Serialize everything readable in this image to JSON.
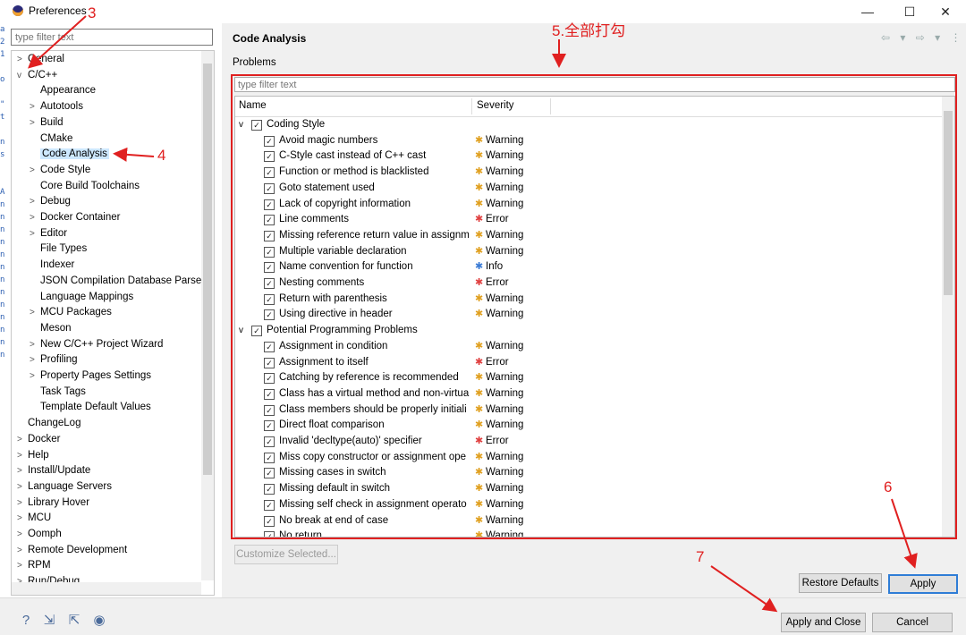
{
  "window": {
    "title": "Preferences",
    "minimize": "—",
    "maximize": "☐",
    "close": "✕"
  },
  "left_strip": [
    "a",
    "2",
    "1",
    "",
    "o",
    "",
    "\"",
    "t",
    "",
    "n",
    "s",
    "",
    "",
    "A",
    "n",
    "n",
    "n",
    "n",
    "n",
    "n",
    "n",
    "n",
    "n",
    "n",
    "n",
    "n",
    "n"
  ],
  "filter": {
    "placeholder": "type filter text"
  },
  "tree": [
    {
      "label": "General",
      "arrow": ">",
      "level": 0
    },
    {
      "label": "C/C++",
      "arrow": "v",
      "level": 0
    },
    {
      "label": "Appearance",
      "arrow": "",
      "level": 1
    },
    {
      "label": "Autotools",
      "arrow": ">",
      "level": 1
    },
    {
      "label": "Build",
      "arrow": ">",
      "level": 1
    },
    {
      "label": "CMake",
      "arrow": "",
      "level": 1
    },
    {
      "label": "Code Analysis",
      "arrow": "",
      "level": 1,
      "selected": true
    },
    {
      "label": "Code Style",
      "arrow": ">",
      "level": 1
    },
    {
      "label": "Core Build Toolchains",
      "arrow": "",
      "level": 1
    },
    {
      "label": "Debug",
      "arrow": ">",
      "level": 1
    },
    {
      "label": "Docker Container",
      "arrow": ">",
      "level": 1
    },
    {
      "label": "Editor",
      "arrow": ">",
      "level": 1
    },
    {
      "label": "File Types",
      "arrow": "",
      "level": 1
    },
    {
      "label": "Indexer",
      "arrow": "",
      "level": 1
    },
    {
      "label": "JSON Compilation Database Parse",
      "arrow": "",
      "level": 1
    },
    {
      "label": "Language Mappings",
      "arrow": "",
      "level": 1
    },
    {
      "label": "MCU Packages",
      "arrow": ">",
      "level": 1
    },
    {
      "label": "Meson",
      "arrow": "",
      "level": 1
    },
    {
      "label": "New C/C++ Project Wizard",
      "arrow": ">",
      "level": 1
    },
    {
      "label": "Profiling",
      "arrow": ">",
      "level": 1
    },
    {
      "label": "Property Pages Settings",
      "arrow": ">",
      "level": 1
    },
    {
      "label": "Task Tags",
      "arrow": "",
      "level": 1
    },
    {
      "label": "Template Default Values",
      "arrow": "",
      "level": 1
    },
    {
      "label": "ChangeLog",
      "arrow": "",
      "level": 0
    },
    {
      "label": "Docker",
      "arrow": ">",
      "level": 0
    },
    {
      "label": "Help",
      "arrow": ">",
      "level": 0
    },
    {
      "label": "Install/Update",
      "arrow": ">",
      "level": 0
    },
    {
      "label": "Language Servers",
      "arrow": ">",
      "level": 0
    },
    {
      "label": "Library Hover",
      "arrow": ">",
      "level": 0
    },
    {
      "label": "MCU",
      "arrow": ">",
      "level": 0
    },
    {
      "label": "Oomph",
      "arrow": ">",
      "level": 0
    },
    {
      "label": "Remote Development",
      "arrow": ">",
      "level": 0
    },
    {
      "label": "RPM",
      "arrow": ">",
      "level": 0
    },
    {
      "label": "Run/Debug",
      "arrow": ">",
      "level": 0
    }
  ],
  "main": {
    "title": "Code Analysis",
    "section_label": "Problems",
    "filter_placeholder": "type filter text",
    "columns": {
      "name": "Name",
      "severity": "Severity"
    },
    "rows": [
      {
        "type": "group",
        "name": "Coding Style"
      },
      {
        "type": "item",
        "name": "Avoid magic numbers",
        "severity": "Warning"
      },
      {
        "type": "item",
        "name": "C-Style cast instead of C++ cast",
        "severity": "Warning"
      },
      {
        "type": "item",
        "name": "Function or method is blacklisted",
        "severity": "Warning"
      },
      {
        "type": "item",
        "name": "Goto statement used",
        "severity": "Warning"
      },
      {
        "type": "item",
        "name": "Lack of copyright information",
        "severity": "Warning"
      },
      {
        "type": "item",
        "name": "Line comments",
        "severity": "Error"
      },
      {
        "type": "item",
        "name": "Missing reference return value in assignm",
        "severity": "Warning"
      },
      {
        "type": "item",
        "name": "Multiple variable declaration",
        "severity": "Warning"
      },
      {
        "type": "item",
        "name": "Name convention for function",
        "severity": "Info"
      },
      {
        "type": "item",
        "name": "Nesting comments",
        "severity": "Error"
      },
      {
        "type": "item",
        "name": "Return with parenthesis",
        "severity": "Warning"
      },
      {
        "type": "item",
        "name": "Using directive in header",
        "severity": "Warning"
      },
      {
        "type": "group",
        "name": "Potential Programming Problems"
      },
      {
        "type": "item",
        "name": "Assignment in condition",
        "severity": "Warning"
      },
      {
        "type": "item",
        "name": "Assignment to itself",
        "severity": "Error"
      },
      {
        "type": "item",
        "name": "Catching by reference is recommended",
        "severity": "Warning"
      },
      {
        "type": "item",
        "name": "Class has a virtual method and non-virtua",
        "severity": "Warning"
      },
      {
        "type": "item",
        "name": "Class members should be properly initiali",
        "severity": "Warning"
      },
      {
        "type": "item",
        "name": "Direct float comparison",
        "severity": "Warning"
      },
      {
        "type": "item",
        "name": "Invalid 'decltype(auto)' specifier",
        "severity": "Error"
      },
      {
        "type": "item",
        "name": "Miss copy constructor or assignment ope",
        "severity": "Warning"
      },
      {
        "type": "item",
        "name": "Missing cases in switch",
        "severity": "Warning"
      },
      {
        "type": "item",
        "name": "Missing default in switch",
        "severity": "Warning"
      },
      {
        "type": "item",
        "name": "Missing self check in assignment operato",
        "severity": "Warning"
      },
      {
        "type": "item",
        "name": "No break at end of case",
        "severity": "Warning"
      },
      {
        "type": "item",
        "name": "No return",
        "severity": "Warning"
      }
    ]
  },
  "buttons": {
    "customize": "Customize Selected...",
    "restore": "Restore Defaults",
    "apply": "Apply",
    "apply_close": "Apply and Close",
    "cancel": "Cancel"
  },
  "annotations": {
    "a3": "3",
    "a4": "4",
    "a5": "5.全部打勾",
    "a6": "6",
    "a7": "7"
  },
  "colors": {
    "annotation": "#e02020",
    "selection": "#cde8ff",
    "warning": "#e0a020",
    "error": "#e04040",
    "info": "#3a7bd5",
    "apply_border": "#2f7dd6"
  },
  "icons": {
    "help": "?",
    "import": "⇲",
    "export": "⇱",
    "record": "◉"
  }
}
